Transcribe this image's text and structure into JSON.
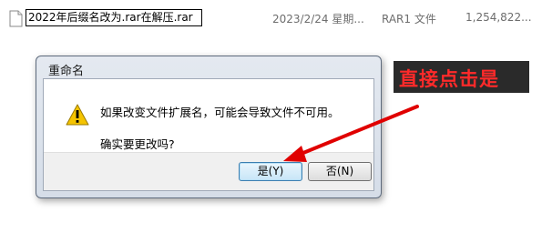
{
  "file": {
    "name_editing": "2022年后缀名改为.rar在解压.rar",
    "date": "2023/2/24 星期...",
    "type": "RAR1 文件",
    "size": "1,254,822..."
  },
  "dialog": {
    "title": "重命名",
    "message": "如果改变文件扩展名，可能会导致文件不可用。",
    "question": "确实要更改吗?",
    "yes_label": "是(Y)",
    "no_label": "否(N)"
  },
  "annotation": {
    "text": "直接点击是",
    "color": "#ff2a2a"
  },
  "icons": {
    "file": "document-icon",
    "warning": "warning-icon"
  }
}
